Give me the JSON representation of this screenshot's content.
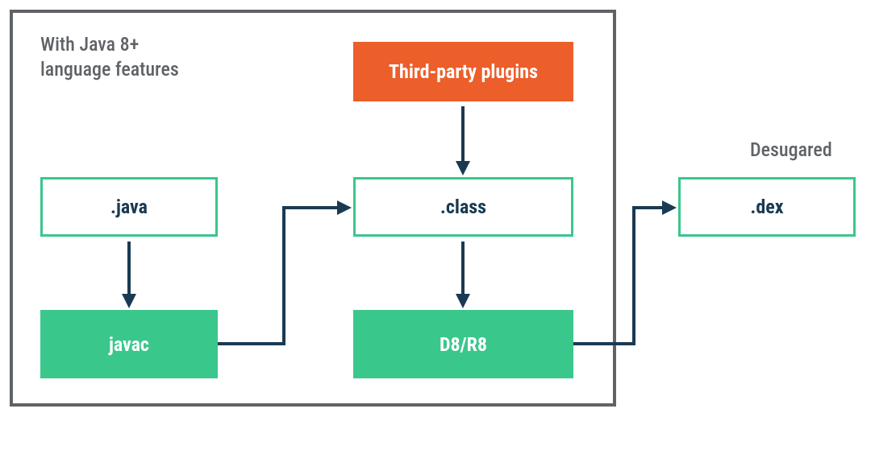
{
  "chart_data": {
    "type": "flow-diagram",
    "title": "With Java 8+ language features",
    "nodes": [
      {
        "id": "java",
        "label": ".java",
        "style": "outline-green",
        "group": "inside"
      },
      {
        "id": "javac",
        "label": "javac",
        "style": "solid-green",
        "group": "inside"
      },
      {
        "id": "plugins",
        "label": "Third-party plugins",
        "style": "solid-orange",
        "group": "inside"
      },
      {
        "id": "class",
        "label": ".class",
        "style": "outline-green",
        "group": "inside"
      },
      {
        "id": "d8r8",
        "label": "D8/R8",
        "style": "solid-green",
        "group": "inside"
      },
      {
        "id": "dex",
        "label": ".dex",
        "style": "outline-green",
        "group": "outside",
        "annotation": "Desugared"
      }
    ],
    "edges": [
      {
        "from": "java",
        "to": "javac"
      },
      {
        "from": "javac",
        "to": "class"
      },
      {
        "from": "plugins",
        "to": "class"
      },
      {
        "from": "class",
        "to": "d8r8"
      },
      {
        "from": "d8r8",
        "to": "dex"
      }
    ],
    "colors": {
      "green": "#3ac78b",
      "orange": "#ec5e2a",
      "dark": "#1a3a52",
      "gray": "#5f6368"
    }
  },
  "header": {
    "line1": "With Java 8+",
    "line2": "language features"
  },
  "boxes": {
    "java": ".java",
    "javac": "javac",
    "plugins": "Third-party plugins",
    "class": ".class",
    "d8r8": "D8/R8",
    "dex": ".dex"
  },
  "labels": {
    "desugared": "Desugared"
  }
}
